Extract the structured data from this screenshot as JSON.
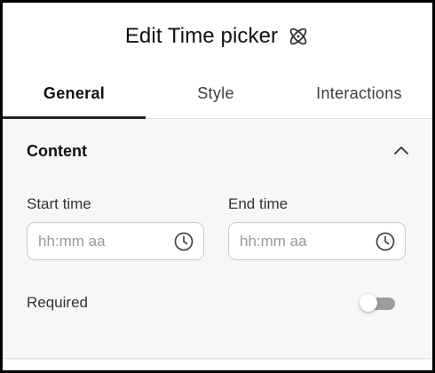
{
  "header": {
    "title": "Edit Time picker",
    "icon": "atom-icon"
  },
  "tabs": [
    {
      "label": "General",
      "active": true
    },
    {
      "label": "Style",
      "active": false
    },
    {
      "label": "Interactions",
      "active": false
    }
  ],
  "content_section": {
    "title": "Content",
    "expanded": true,
    "start_time": {
      "label": "Start time",
      "placeholder": "hh:mm aa",
      "value": ""
    },
    "end_time": {
      "label": "End time",
      "placeholder": "hh:mm aa",
      "value": ""
    },
    "required": {
      "label": "Required",
      "checked": false
    }
  },
  "colors": {
    "active_tab_indicator": "#202020",
    "section_background": "#f7f7f7",
    "toggle_track_off": "#9d9d9d",
    "border": "#c9c9c9"
  }
}
